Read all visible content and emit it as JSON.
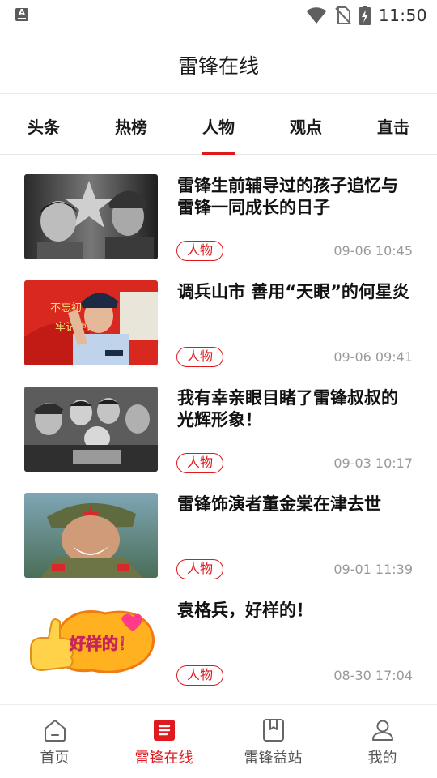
{
  "status_bar": {
    "notification_icon": "text-a-icon",
    "time": "11:50",
    "icons": [
      "wifi-icon",
      "no-sim-icon",
      "battery-charging-icon"
    ]
  },
  "header": {
    "title": "雷锋在线"
  },
  "tabs": [
    {
      "label": "头条",
      "active": false
    },
    {
      "label": "热榜",
      "active": false
    },
    {
      "label": "人物",
      "active": true
    },
    {
      "label": "观点",
      "active": false
    },
    {
      "label": "直击",
      "active": false
    }
  ],
  "news": [
    {
      "title": "雷锋生前辅导过的孩子追忆与雷锋一同成长的日子",
      "tag": "人物",
      "time": "09-06 10:45",
      "thumb": "photo-leifeng-with-child"
    },
    {
      "title": "调兵山市 善用“天眼”的何星炎",
      "tag": "人物",
      "time": "09-06 09:41",
      "thumb": "photo-police-salute"
    },
    {
      "title": "我有幸亲眼目睹了雷锋叔叔的光辉形象！",
      "tag": "人物",
      "time": "09-03 10:17",
      "thumb": "photo-leifeng-with-children"
    },
    {
      "title": "雷锋饰演者董金棠在津去世",
      "tag": "人物",
      "time": "09-01 11:39",
      "thumb": "photo-soldier-portrait"
    },
    {
      "title": "袁格兵，好样的！",
      "tag": "人物",
      "time": "08-30 17:04",
      "thumb": "thumbs-up-badge",
      "thumb_text": "好样的！"
    }
  ],
  "bottom_nav": [
    {
      "label": "首页",
      "icon": "home-icon",
      "active": false
    },
    {
      "label": "雷锋在线",
      "icon": "list-doc-icon",
      "active": true
    },
    {
      "label": "雷锋益站",
      "icon": "bookmark-book-icon",
      "active": false
    },
    {
      "label": "我的",
      "icon": "user-icon",
      "active": false
    }
  ],
  "colors": {
    "accent": "#e0191f",
    "text": "#111111",
    "muted": "#999999"
  }
}
